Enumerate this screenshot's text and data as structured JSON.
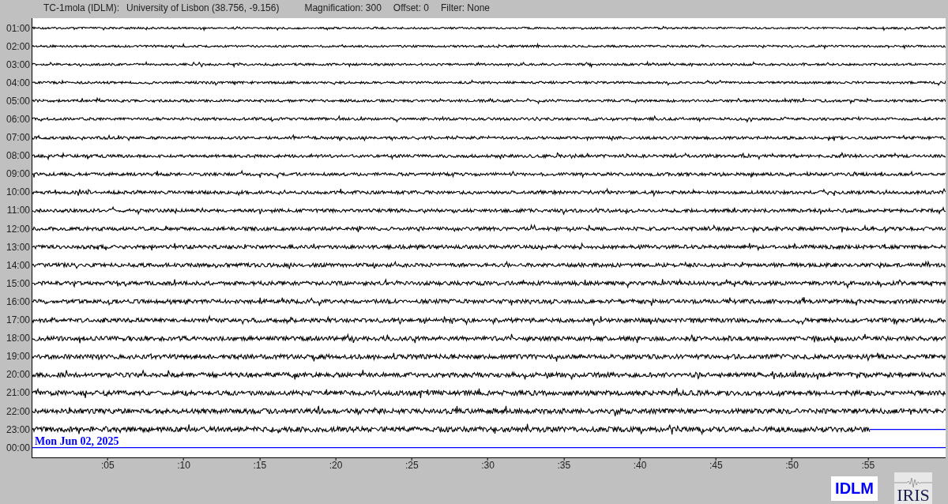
{
  "header": {
    "station": "TC-1mola (IDLM):",
    "location": "University of Lisbon (38.756, -9.156)",
    "magnification": "Magnification: 300",
    "offset": "Offset: 0",
    "filter": "Filter: None"
  },
  "rows": [
    {
      "time": "01:00",
      "level": 1
    },
    {
      "time": "02:00",
      "level": 1
    },
    {
      "time": "03:00",
      "level": 1
    },
    {
      "time": "04:00",
      "level": 1
    },
    {
      "time": "05:00",
      "level": 1
    },
    {
      "time": "06:00",
      "level": 1
    },
    {
      "time": "07:00",
      "level": 1
    },
    {
      "time": "08:00",
      "level": 1
    },
    {
      "time": "09:00",
      "level": 1
    },
    {
      "time": "10:00",
      "level": 1
    },
    {
      "time": "11:00",
      "level": 1
    },
    {
      "time": "12:00",
      "level": 1
    },
    {
      "time": "13:00",
      "level": 1
    },
    {
      "time": "14:00",
      "level": 1
    },
    {
      "time": "15:00",
      "level": 1
    },
    {
      "time": "16:00",
      "level": 1
    },
    {
      "time": "17:00",
      "level": 1
    },
    {
      "time": "18:00",
      "level": 1
    },
    {
      "time": "19:00",
      "level": 1
    },
    {
      "time": "20:00",
      "level": 1
    },
    {
      "time": "21:00",
      "level": 1
    },
    {
      "time": "22:00",
      "level": 1
    },
    {
      "time": "23:00",
      "level": 0.917
    },
    {
      "time": "00:00",
      "kind": "empty"
    }
  ],
  "date": "Mon Jun 02, 2025",
  "x_ticks": [
    ":05",
    ":10",
    ":15",
    ":20",
    ":25",
    ":30",
    ":35",
    ":40",
    ":45",
    ":50",
    ":55"
  ],
  "logos": {
    "network": "IDLM",
    "consortium": "IRIS"
  }
}
